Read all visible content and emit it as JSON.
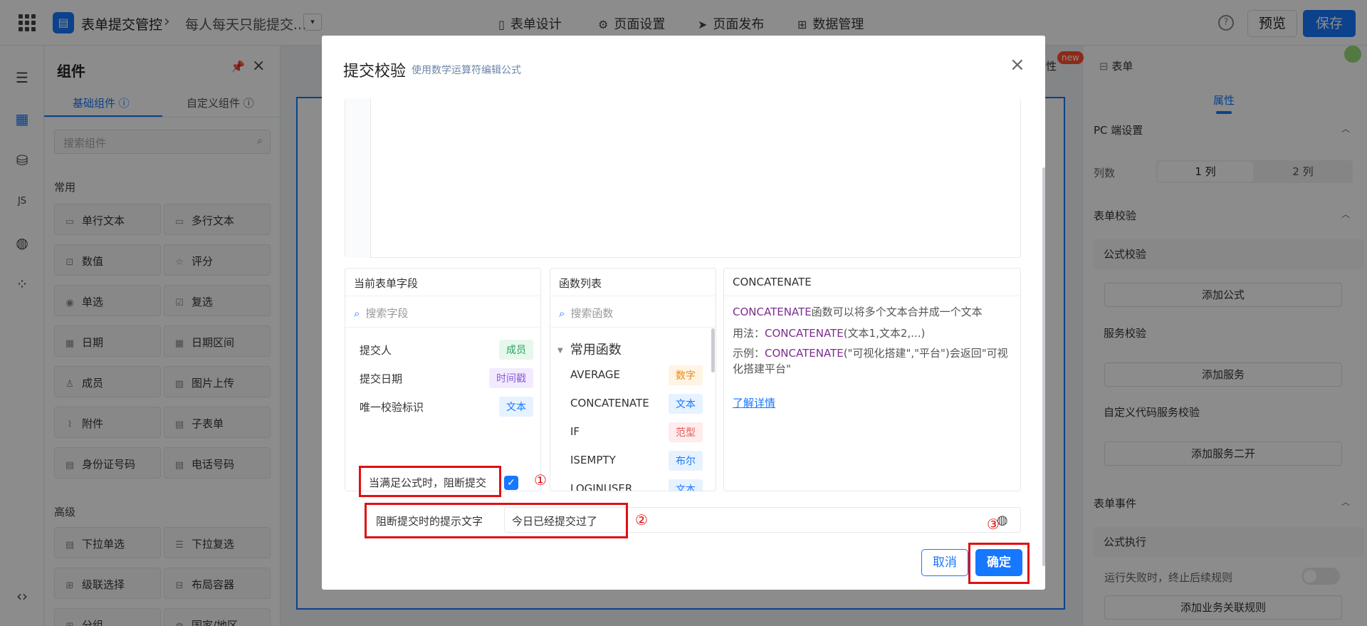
{
  "topbar": {
    "app_name": "表单提交管控",
    "crumb_sep": "›",
    "page_name": "每人每天只能提交...",
    "dropdown_glyph": "▾",
    "tabs": [
      {
        "label": "表单设计",
        "icon": "document-icon"
      },
      {
        "label": "页面设置",
        "icon": "gear-icon"
      },
      {
        "label": "页面发布",
        "icon": "send-icon"
      },
      {
        "label": "数据管理",
        "icon": "table-icon"
      }
    ],
    "help": "?",
    "preview": "预览",
    "save": "保存"
  },
  "panel": {
    "title": "组件",
    "tabs": [
      "基础组件",
      "自定义组件"
    ],
    "search_placeholder": "搜索组件",
    "sections": [
      {
        "label": "常用",
        "items": [
          "单行文本",
          "多行文本",
          "数值",
          "评分",
          "单选",
          "复选",
          "日期",
          "日期区间",
          "成员",
          "图片上传",
          "附件",
          "子表单",
          "身份证号码",
          "电话号码"
        ]
      },
      {
        "label": "高级",
        "items": [
          "下拉单选",
          "下拉复选",
          "级联选择",
          "布局容器",
          "分组",
          "国家/地区"
        ]
      }
    ]
  },
  "right": {
    "tab_props": "属性",
    "tab_form": "表单",
    "new_badge": "new",
    "active_tab": "属性",
    "pc_settings": "PC 端设置",
    "columns_label": "列数",
    "col1": "1 列",
    "col2": "2 列",
    "form_validation": "表单校验",
    "formula_validation": "公式校验",
    "add_formula": "添加公式",
    "service_validation": "服务校验",
    "add_service": "添加服务",
    "custom_code_validation": "自定义代码服务校验",
    "add_service_2": "添加服务二开",
    "form_events": "表单事件",
    "formula_exec": "公式执行",
    "fail_stop": "运行失败时，终止后续规则",
    "add_biz_rule": "添加业务关联规则"
  },
  "modal": {
    "title": "提交校验",
    "subtitle": "使用数学运算符编辑公式",
    "close": "×",
    "fields_pane": {
      "header": "当前表单字段",
      "search_placeholder": "搜索字段",
      "rows": [
        {
          "label": "提交人",
          "tag": "成员",
          "tone": "green"
        },
        {
          "label": "提交日期",
          "tag": "时间戳",
          "tone": "purple"
        },
        {
          "label": "唯一校验标识",
          "tag": "文本",
          "tone": "blue"
        }
      ]
    },
    "functions_pane": {
      "header": "函数列表",
      "search_placeholder": "搜索函数",
      "group": "常用函数",
      "rows": [
        {
          "label": "AVERAGE",
          "tag": "数字",
          "tone": "orange"
        },
        {
          "label": "CONCATENATE",
          "tag": "文本",
          "tone": "blue"
        },
        {
          "label": "IF",
          "tag": "范型",
          "tone": "red"
        },
        {
          "label": "ISEMPTY",
          "tag": "布尔",
          "tone": "blue"
        },
        {
          "label": "LOGINUSER",
          "tag": "文本",
          "tone": "blue"
        }
      ]
    },
    "desc_pane": {
      "header": "CONCATENATE",
      "fn": "CONCATENATE",
      "line1_rest": "函数可以将多个文本合并成一个文本",
      "usage_prefix": "用法：",
      "usage_rest": "(文本1,文本2,...)",
      "example_prefix": "示例：",
      "example_rest": "(\"可视化搭建\",\"平台\")会返回\"可视化搭建平台\"",
      "link": "了解详情"
    },
    "block_label": "当满足公式时，阻断提交",
    "block_checked": "✓",
    "tip_label": "阻断提交时的提示文字",
    "tip_value": "今日已经提交过了",
    "cancel": "取消",
    "ok": "确定",
    "markers": [
      "①",
      "②",
      "③"
    ]
  }
}
